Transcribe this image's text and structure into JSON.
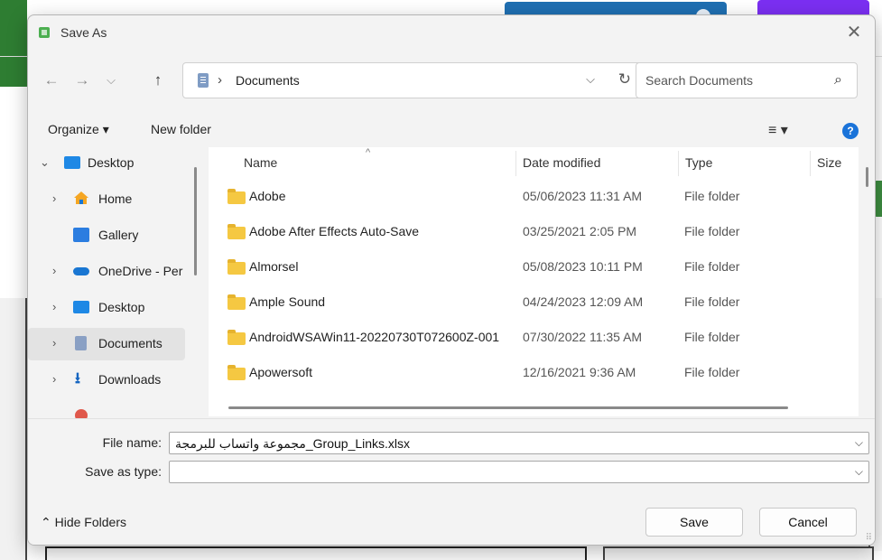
{
  "dialog": {
    "title": "Save As",
    "close_glyph": "✕"
  },
  "nav": {
    "back_glyph": "←",
    "forward_glyph": "→",
    "recent_glyph": "⌵",
    "up_glyph": "↑"
  },
  "address": {
    "separator": "›",
    "path": "Documents",
    "dropdown_glyph": "⌵",
    "refresh_glyph": "↻"
  },
  "search": {
    "placeholder": "Search Documents",
    "icon_glyph": "⌕"
  },
  "toolbar": {
    "organize_label": "Organize ▾",
    "new_folder_label": "New folder",
    "view_label": "≡ ▾",
    "help_label": "?"
  },
  "navpane": {
    "items": [
      {
        "label": "Desktop",
        "icon": "desktop-icon",
        "chevron": "⌄"
      },
      {
        "label": "Home",
        "icon": "home-icon",
        "chevron": "›"
      },
      {
        "label": "Gallery",
        "icon": "gallery-icon",
        "chevron": ""
      },
      {
        "label": "OneDrive - Per",
        "icon": "onedrive-icon",
        "chevron": "›"
      },
      {
        "label": "Desktop",
        "icon": "desktop-icon",
        "chevron": "›"
      },
      {
        "label": "Documents",
        "icon": "documents-icon",
        "chevron": "›"
      },
      {
        "label": "Downloads",
        "icon": "downloads-icon",
        "chevron": "›"
      }
    ]
  },
  "filelist": {
    "sort_glyph": "^",
    "headers": {
      "name": "Name",
      "date": "Date modified",
      "type": "Type",
      "size": "Size"
    },
    "rows": [
      {
        "name": "Adobe",
        "date": "05/06/2023 11:31 AM",
        "type": "File folder"
      },
      {
        "name": "Adobe After Effects Auto-Save",
        "date": "03/25/2021 2:05 PM",
        "type": "File folder"
      },
      {
        "name": "Almorsel",
        "date": "05/08/2023 10:11 PM",
        "type": "File folder"
      },
      {
        "name": "Ample Sound",
        "date": "04/24/2023 12:09 AM",
        "type": "File folder"
      },
      {
        "name": "AndroidWSAWin11-20220730T072600Z-001",
        "date": "07/30/2022 11:35 AM",
        "type": "File folder"
      },
      {
        "name": "Apowersoft",
        "date": "12/16/2021 9:36 AM",
        "type": "File folder"
      }
    ]
  },
  "form": {
    "file_name_label": "File name:",
    "file_name_value": "مجموعة واتساب للبرمجة_Group_Links.xlsx",
    "save_type_label": "Save as type:",
    "save_type_value": "",
    "dropdown_glyph": "⌵"
  },
  "footer": {
    "hide_folders_label": "⌃ Hide Folders",
    "save_label": "Save",
    "cancel_label": "Cancel"
  },
  "colors": {
    "accent": "#1a73d9",
    "folder": "#f5c842",
    "selected_row": "#e3e3e3"
  }
}
